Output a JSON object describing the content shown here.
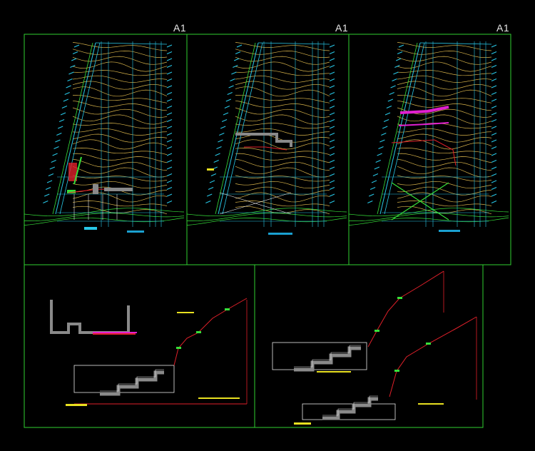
{
  "drawing": {
    "background": "#000000",
    "frame_color": "#2fd12f",
    "top_sheets": [
      {
        "label": "A1"
      },
      {
        "label": "A1"
      },
      {
        "label": "A1"
      }
    ],
    "colors": {
      "contour": "#d6b24a",
      "grid": "#28c8e8",
      "wall": "#e8e8e8",
      "red": "#e0202a",
      "magenta": "#e020d0",
      "green": "#36e03a",
      "yellow": "#e8e020",
      "hatch": "#8a8a8a",
      "tag": "#1aa0d0"
    }
  }
}
